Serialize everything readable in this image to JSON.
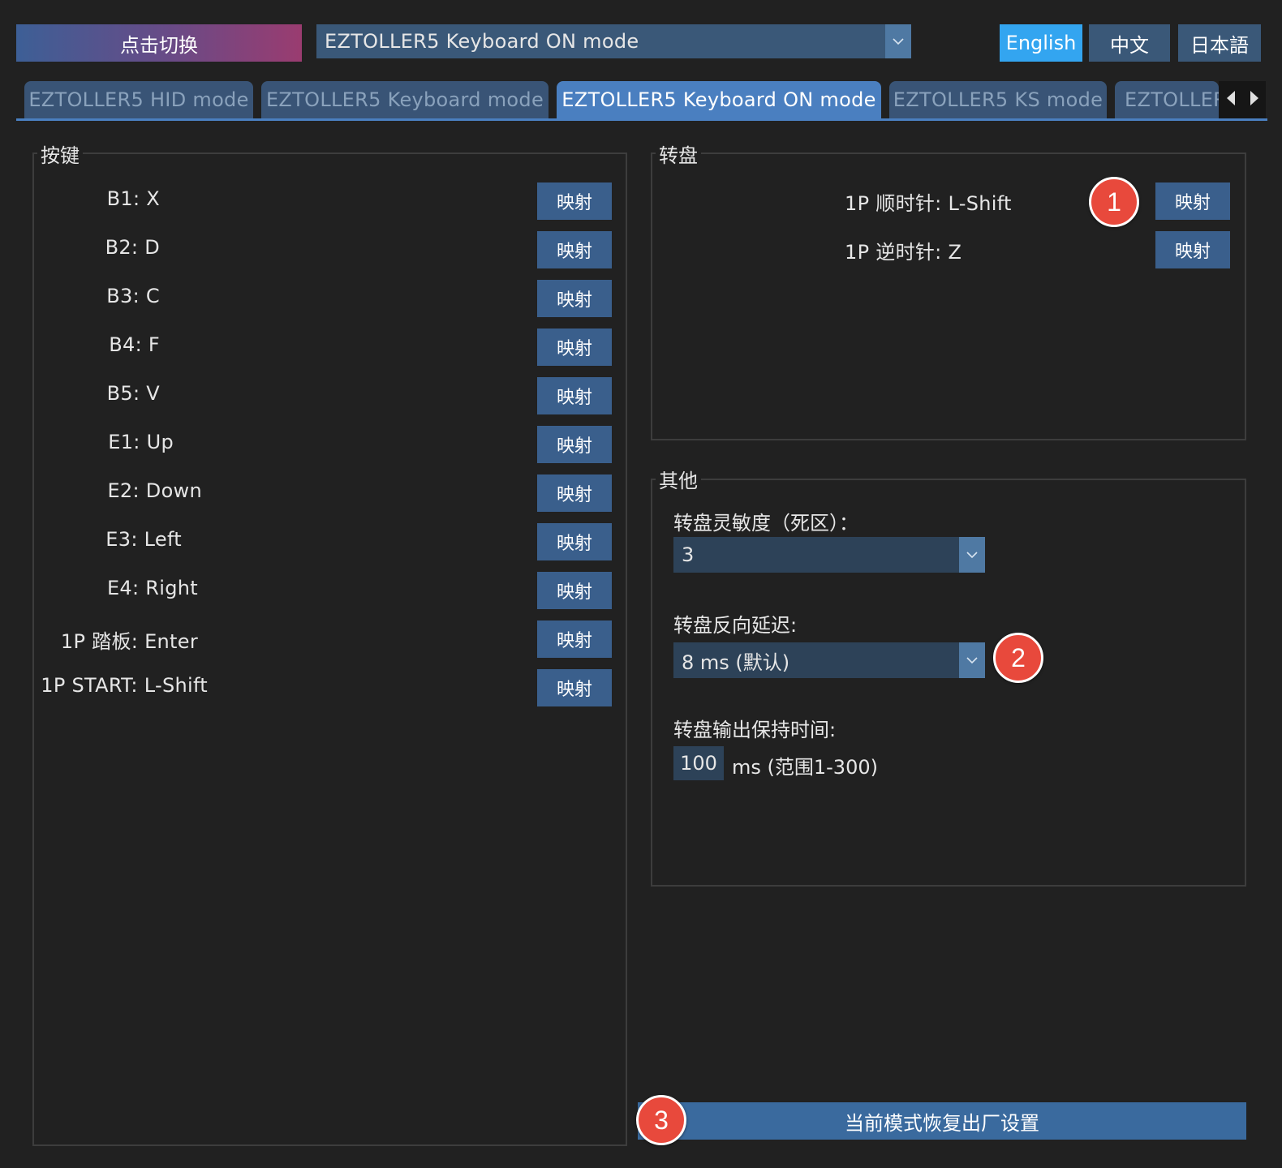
{
  "header": {
    "switch_label": "点击切换",
    "mode_selected": "EZTOLLER5 Keyboard ON mode",
    "languages": [
      "English",
      "中文",
      "日本語"
    ],
    "active_language": "English"
  },
  "tabs": [
    {
      "label": "EZTOLLER5 HID mode"
    },
    {
      "label": "EZTOLLER5 Keyboard mode"
    },
    {
      "label": "EZTOLLER5 Keyboard ON mode"
    },
    {
      "label": "EZTOLLER5 KS mode"
    },
    {
      "label": "EZTOLLER"
    }
  ],
  "active_tab": "EZTOLLER5 Keyboard ON mode",
  "keys_group": {
    "title": "按键",
    "map_label": "映射",
    "rows": [
      {
        "label": "B1: X"
      },
      {
        "label": "B2: D"
      },
      {
        "label": "B3: C"
      },
      {
        "label": "B4: F"
      },
      {
        "label": "B5: V"
      },
      {
        "label": "E1: Up"
      },
      {
        "label": "E2: Down"
      },
      {
        "label": "E3: Left"
      },
      {
        "label": "E4: Right"
      },
      {
        "label": "1P 踏板: Enter"
      },
      {
        "label": "1P START: L-Shift"
      }
    ]
  },
  "turntable_group": {
    "title": "转盘",
    "map_label": "映射",
    "rows": [
      {
        "label": "1P 顺时针: L-Shift"
      },
      {
        "label": "1P 逆时针: Z"
      }
    ]
  },
  "other_group": {
    "title": "其他",
    "sensitivity_label": "转盘灵敏度（死区）：",
    "sensitivity_value": "3",
    "reverse_delay_label": "转盘反向延迟:",
    "reverse_delay_value": "8 ms (默认)",
    "hold_time_label": "转盘输出保持时间:",
    "hold_time_value": "100",
    "hold_time_suffix": "ms (范围1-300)"
  },
  "reset_label": "当前模式恢复出厂设置",
  "annotations": [
    "1",
    "2",
    "3"
  ],
  "colors": {
    "background": "#212121",
    "accent": "#4a7fc0",
    "active_language": "#33a5f0",
    "button": "#3a5f8c",
    "badge": "#e8493c"
  }
}
